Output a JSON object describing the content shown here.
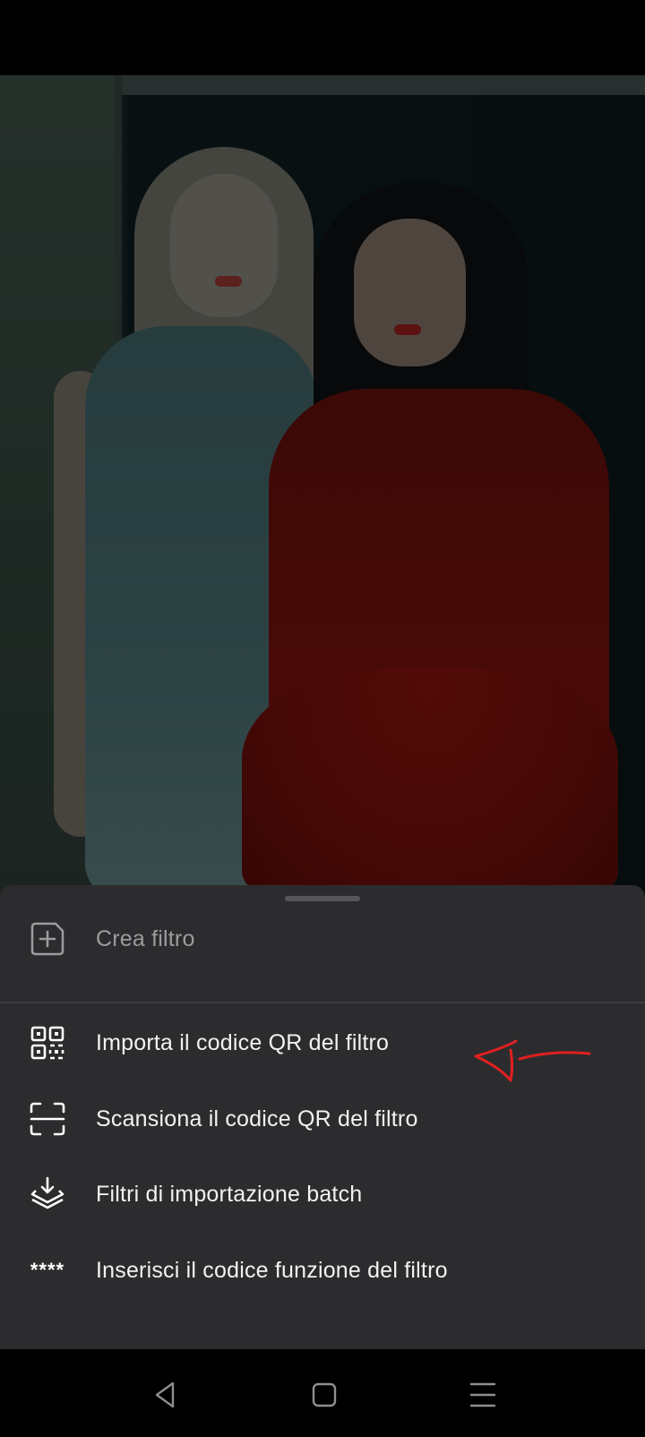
{
  "sheet": {
    "items": [
      {
        "label": "Crea filtro",
        "icon": "add-filter-icon"
      },
      {
        "label": "Importa il codice QR del filtro",
        "icon": "qr-code-icon"
      },
      {
        "label": "Scansiona il codice QR del filtro",
        "icon": "scan-frame-icon"
      },
      {
        "label": "Filtri di importazione batch",
        "icon": "import-layers-icon"
      },
      {
        "label": "Inserisci il codice funzione del filtro",
        "icon": "code-dots-icon",
        "icon_text": "****"
      }
    ]
  },
  "colors": {
    "sheet_bg": "#2c2c2e",
    "text_primary": "#f2f2f2",
    "text_dim": "#9c9c9e",
    "annotation": "#e02020",
    "nav_icon": "#8e8e93"
  },
  "nav": {
    "items": [
      "back-icon",
      "home-icon",
      "menu-icon"
    ]
  }
}
